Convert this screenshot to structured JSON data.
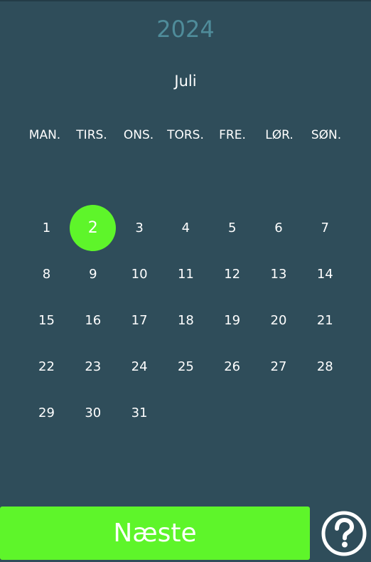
{
  "calendar": {
    "year": "2024",
    "month": "Juli",
    "weekdays": [
      "MAN.",
      "TIRS.",
      "ONS.",
      "TORS.",
      "FRE.",
      "LØR.",
      "SØN."
    ],
    "days": [
      "1",
      "2",
      "3",
      "4",
      "5",
      "6",
      "7",
      "8",
      "9",
      "10",
      "11",
      "12",
      "13",
      "14",
      "15",
      "16",
      "17",
      "18",
      "19",
      "20",
      "21",
      "22",
      "23",
      "24",
      "25",
      "26",
      "27",
      "28",
      "29",
      "30",
      "31"
    ],
    "selected_day": "2"
  },
  "footer": {
    "next_label": "Næste",
    "help_icon": "question-circle-icon"
  },
  "colors": {
    "background": "#2f4d5a",
    "year_text": "#4f8c9a",
    "accent": "#5ef52a",
    "text": "#ffffff"
  }
}
